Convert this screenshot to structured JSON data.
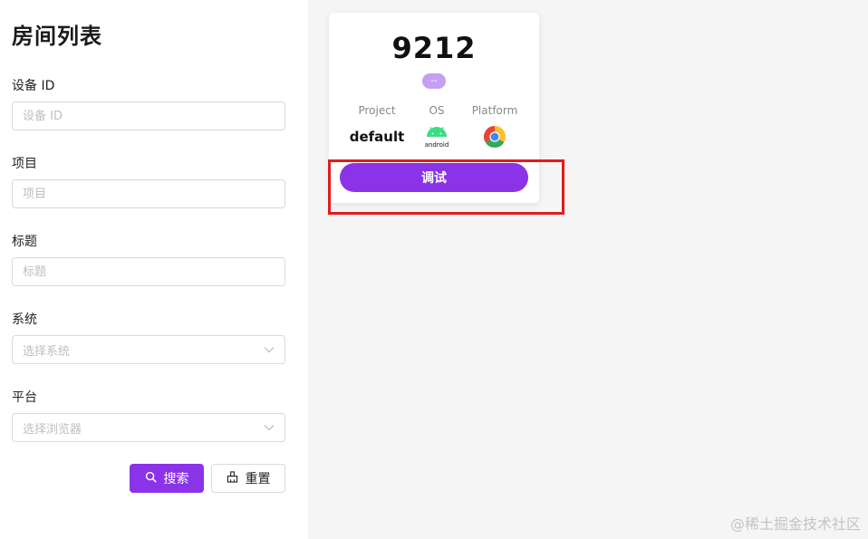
{
  "sidebar": {
    "title": "房间列表",
    "fields": [
      {
        "label": "设备 ID",
        "placeholder": "设备 ID"
      },
      {
        "label": "项目",
        "placeholder": "项目"
      },
      {
        "label": "标题",
        "placeholder": "标题"
      },
      {
        "label": "系统",
        "placeholder": "选择系统"
      },
      {
        "label": "平台",
        "placeholder": "选择浏览器"
      }
    ],
    "search_label": "搜索",
    "reset_label": "重置"
  },
  "card": {
    "title": "9212",
    "tag": "--",
    "columns": [
      {
        "label": "Project",
        "value": "default"
      },
      {
        "label": "OS",
        "icon": "android-icon",
        "icon_text": "android"
      },
      {
        "label": "Platform",
        "icon": "chrome-icon"
      }
    ],
    "debug_label": "调试"
  },
  "colors": {
    "accent": "#8a33e8",
    "tag": "#c69ef2",
    "highlight": "#e11c1c",
    "android_green": "#3ddc84"
  },
  "watermark": "@稀土掘金技术社区"
}
